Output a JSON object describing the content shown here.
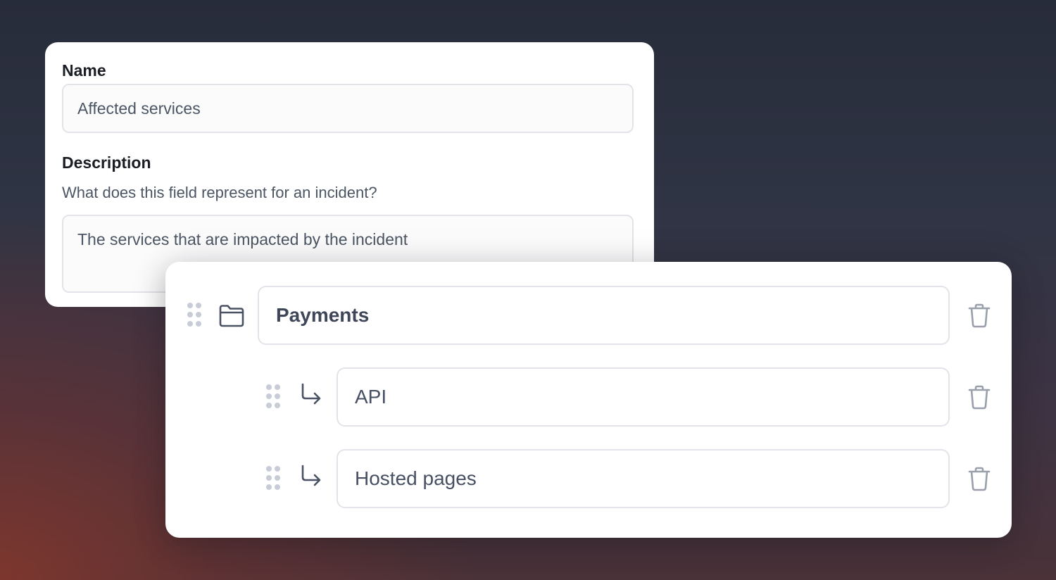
{
  "field": {
    "name_label": "Name",
    "name_value": "Affected services",
    "description_label": "Description",
    "description_helper": "What does this field represent for an incident?",
    "description_value": "The services that are impacted by the incident"
  },
  "options": {
    "parent": {
      "label": "Payments",
      "icon": "folder-icon"
    },
    "children": [
      {
        "label": "API",
        "icon": "arrow-return-icon"
      },
      {
        "label": "Hosted pages",
        "icon": "arrow-return-icon"
      }
    ],
    "delete_icon": "trash-icon",
    "drag_icon": "drag-handle-icon"
  }
}
